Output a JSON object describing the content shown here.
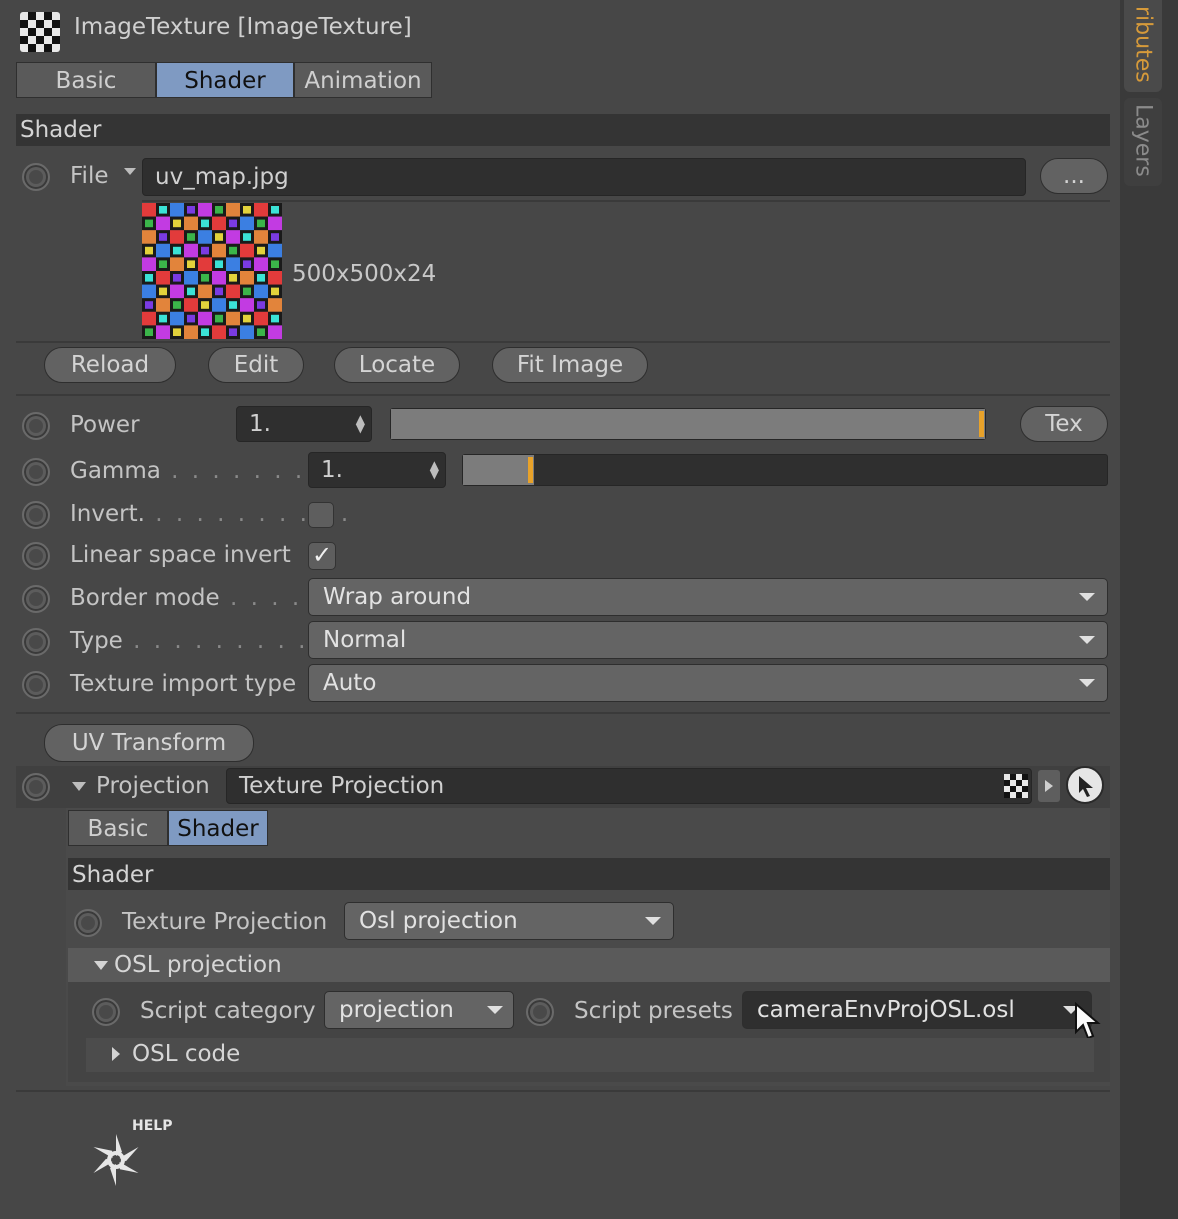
{
  "header": {
    "title": "ImageTexture [ImageTexture]"
  },
  "side_tabs": [
    {
      "label": "ributes",
      "active": true
    },
    {
      "label": "Layers",
      "active": false
    }
  ],
  "main_tabs": [
    {
      "label": "Basic",
      "active": false
    },
    {
      "label": "Shader",
      "active": true
    },
    {
      "label": "Animation",
      "active": false
    }
  ],
  "shader_section": {
    "title": "Shader"
  },
  "file": {
    "label": "File",
    "value": "uv_map.jpg",
    "browse_label": "..."
  },
  "preview": {
    "info": "500x500x24"
  },
  "file_buttons": {
    "reload": "Reload",
    "edit": "Edit",
    "locate": "Locate",
    "fit_image": "Fit Image"
  },
  "power": {
    "label": "Power",
    "value": "1.",
    "slider_fraction": 1.0,
    "tex_button": "Tex"
  },
  "gamma": {
    "label": "Gamma",
    "value": "1.",
    "slider_fraction": 0.11
  },
  "invert": {
    "label": "Invert.",
    "checked": false
  },
  "linear_space_invert": {
    "label": "Linear space invert",
    "checked": true
  },
  "border_mode": {
    "label": "Border mode",
    "value": "Wrap around"
  },
  "type": {
    "label": "Type",
    "value": "Normal"
  },
  "texture_import_type": {
    "label": "Texture import type",
    "value": "Auto"
  },
  "uv_transform": {
    "label": "UV Transform"
  },
  "projection": {
    "label": "Projection",
    "value": "Texture Projection"
  },
  "sub_tabs": [
    {
      "label": "Basic",
      "active": false
    },
    {
      "label": "Shader",
      "active": true
    }
  ],
  "sub_shader": {
    "title": "Shader"
  },
  "texture_projection": {
    "label": "Texture Projection",
    "value": "Osl projection"
  },
  "osl_projection": {
    "title": "OSL projection"
  },
  "script_category": {
    "label": "Script category",
    "value": "projection"
  },
  "script_presets": {
    "label": "Script presets",
    "value": "cameraEnvProjOSL.osl"
  },
  "osl_code": {
    "title": "OSL code"
  },
  "help": {
    "label": "HELP"
  },
  "colors": {
    "accent": "#d69a3a",
    "active_tab": "#7f9ac2",
    "slider_marker": "#e8a22a"
  }
}
